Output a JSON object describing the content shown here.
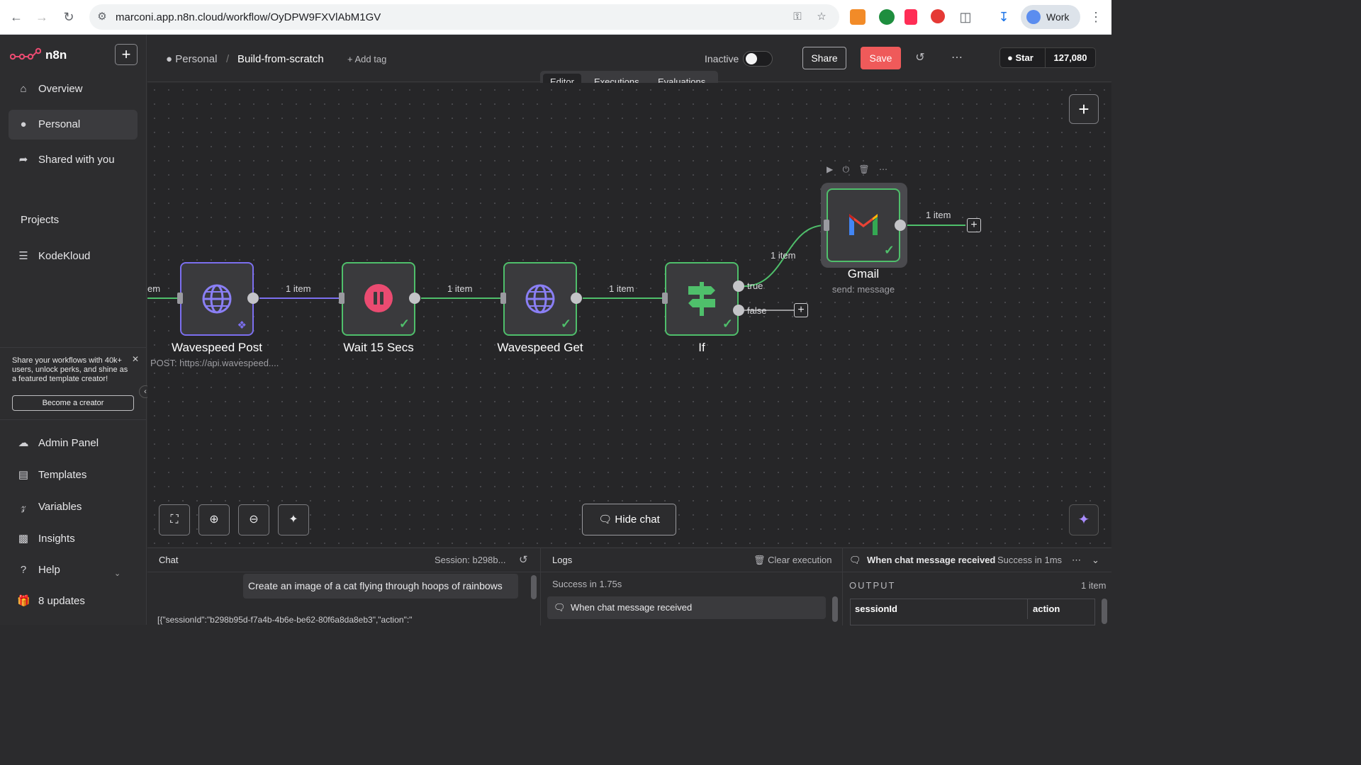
{
  "browser": {
    "url": "marconi.app.n8n.cloud/workflow/OyDPW9FXVlAbM1GV",
    "profile": "Work"
  },
  "sidebar": {
    "logo_text": "n8n",
    "items": [
      {
        "label": "Overview",
        "icon": "home-icon"
      },
      {
        "label": "Personal",
        "icon": "user-icon"
      },
      {
        "label": "Shared with you",
        "icon": "share-icon"
      }
    ],
    "projects_label": "Projects",
    "project": {
      "label": "KodeKloud",
      "icon": "layers-icon"
    },
    "promo": {
      "text": "Share your workflows with 40k+ users, unlock perks, and shine as a featured template creator!",
      "button": "Become a creator"
    },
    "bottom_items": [
      {
        "label": "Admin Panel",
        "icon": "cloud-icon"
      },
      {
        "label": "Templates",
        "icon": "box-icon"
      },
      {
        "label": "Variables",
        "icon": "variables-icon"
      },
      {
        "label": "Insights",
        "icon": "chart-icon"
      },
      {
        "label": "Help",
        "icon": "help-icon"
      },
      {
        "label": "8 updates",
        "icon": "gift-icon"
      }
    ]
  },
  "header": {
    "breadcrumb_project": "Personal",
    "breadcrumb_sep": "/",
    "workflow_name": "Build-from-scratch",
    "add_tag": "+ Add tag",
    "status_label": "Inactive",
    "share": "Share",
    "save": "Save",
    "github_star": "Star",
    "github_count": "127,080"
  },
  "tabs": [
    "Editor",
    "Executions",
    "Evaluations"
  ],
  "canvas": {
    "edge_left_label": "em",
    "nodes": [
      {
        "name": "Wavespeed Post",
        "subtitle": "POST: https://api.wavespeed....",
        "icon": "globe-icon"
      },
      {
        "name": "Wait 15 Secs",
        "subtitle": "",
        "icon": "pause-icon"
      },
      {
        "name": "Wavespeed Get",
        "subtitle": "",
        "icon": "globe-icon"
      },
      {
        "name": "If",
        "subtitle": "",
        "icon": "signpost-icon"
      },
      {
        "name": "Gmail",
        "subtitle": "send: message",
        "icon": "gmail-icon"
      }
    ],
    "connection_labels": [
      "1 item",
      "1 item",
      "1 item",
      "1 item",
      "1 item"
    ],
    "branch_true": "true",
    "branch_false": "false",
    "hide_chat": "Hide chat"
  },
  "bottom": {
    "chat_title": "Chat",
    "session": "Session: b298b...",
    "chat_message": "Create an image of a cat flying through hoops of rainbows",
    "chat_cut_text": "[{\"sessionId\":\"b298b95d-f7a4b-4b6e-be62-80f6a8da8eb3\",\"action\":\"",
    "logs_title": "Logs",
    "clear_execution": "Clear execution",
    "logs_status": "Success in 1.75s",
    "log_entry": "When chat message received",
    "output_trigger": "When chat message received",
    "output_status": "Success in 1ms",
    "output_label": "OUTPUT",
    "output_count": "1 item",
    "columns": [
      "sessionId",
      "action"
    ]
  },
  "colors": {
    "accent_save": "#ef5a5a",
    "success": "#4fbf6b",
    "purple_edge": "#7c6ff0"
  }
}
